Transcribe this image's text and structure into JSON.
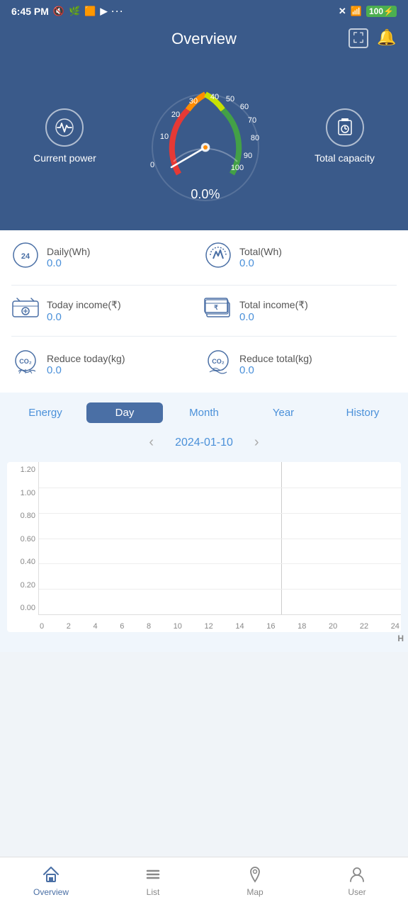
{
  "statusBar": {
    "time": "6:45 PM",
    "battery": "100"
  },
  "header": {
    "title": "Overview",
    "expandIcon": "⛶",
    "bellIcon": "🔔"
  },
  "hero": {
    "currentPower": {
      "label": "Current power",
      "icon": "〜"
    },
    "gauge": {
      "value": "0.0%",
      "labels": [
        "0",
        "10",
        "20",
        "30",
        "40",
        "50",
        "60",
        "70",
        "80",
        "90",
        "100"
      ]
    },
    "totalCapacity": {
      "label": "Total capacity",
      "icon": "⊡"
    }
  },
  "stats": [
    {
      "icon": "24h",
      "label": "Daily(Wh)",
      "value": "0.0",
      "icon2": "⚡",
      "label2": "Total(Wh)",
      "value2": "0.0"
    },
    {
      "label": "Today income(₹)",
      "value": "0.0",
      "label2": "Total income(₹)",
      "value2": "0.0"
    },
    {
      "label": "Reduce today(kg)",
      "value": "0.0",
      "label2": "Reduce total(kg)",
      "value2": "0.0"
    }
  ],
  "chart": {
    "tabs": [
      "Energy",
      "Day",
      "Month",
      "Year",
      "History"
    ],
    "activeTab": "Day",
    "date": "2024-01-10",
    "yLabels": [
      "1.20",
      "1.00",
      "0.80",
      "0.60",
      "0.40",
      "0.20",
      "0.00"
    ],
    "xLabels": [
      "0",
      "2",
      "4",
      "6",
      "8",
      "10",
      "12",
      "14",
      "16",
      "18",
      "20",
      "22",
      "24"
    ],
    "unit": "H"
  },
  "bottomNav": {
    "items": [
      {
        "label": "Overview",
        "icon": "🏠",
        "active": true
      },
      {
        "label": "List",
        "icon": "☰",
        "active": false
      },
      {
        "label": "Map",
        "icon": "📍",
        "active": false
      },
      {
        "label": "User",
        "icon": "👤",
        "active": false
      }
    ]
  }
}
